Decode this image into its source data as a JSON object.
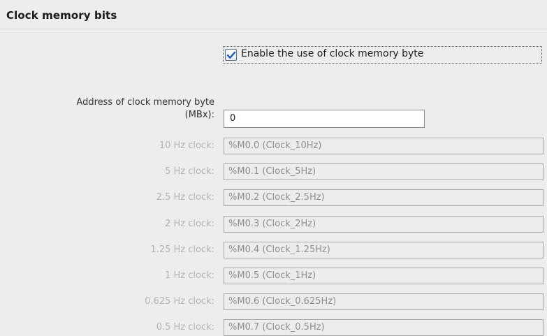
{
  "section": {
    "title": "Clock memory bits"
  },
  "enable": {
    "checked": true,
    "label": "Enable the use of clock memory byte"
  },
  "address": {
    "label_line1": "Address of clock memory byte",
    "label_line2": "(MBx):",
    "value": "0"
  },
  "clocks": [
    {
      "label": "10 Hz clock:",
      "value": "%M0.0 (Clock_10Hz)"
    },
    {
      "label": "5 Hz clock:",
      "value": "%M0.1 (Clock_5Hz)"
    },
    {
      "label": "2.5 Hz clock:",
      "value": "%M0.2 (Clock_2.5Hz)"
    },
    {
      "label": "2 Hz clock:",
      "value": "%M0.3 (Clock_2Hz)"
    },
    {
      "label": "1.25 Hz clock:",
      "value": "%M0.4 (Clock_1.25Hz)"
    },
    {
      "label": "1 Hz clock:",
      "value": "%M0.5 (Clock_1Hz)"
    },
    {
      "label": "0.625 Hz clock:",
      "value": "%M0.6 (Clock_0.625Hz)"
    },
    {
      "label": "0.5 Hz clock:",
      "value": "%M0.7 (Clock_0.5Hz)"
    }
  ],
  "colors": {
    "checkmark": "#1e5bb8",
    "disabled_text": "#b3b3b3",
    "background": "#ededed"
  }
}
